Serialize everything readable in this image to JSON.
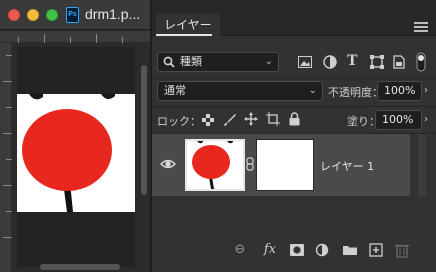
{
  "document": {
    "title": "drm1.p...",
    "app_badge": "Ps"
  },
  "panel": {
    "tab_label": "レイヤー",
    "filter": {
      "kind_label": "種類"
    },
    "blend_mode": "通常",
    "opacity_label": "不透明度：",
    "opacity_value": "100%",
    "lock_label": "ロック：",
    "fill_label": "塗り：",
    "fill_value": "100%",
    "layers": [
      {
        "name": "レイヤー 1",
        "visible": true,
        "selected": true
      }
    ]
  },
  "colors": {
    "panel_bg": "#323232",
    "selected_row": "#4a4a4a",
    "red_circle": "#e8271e",
    "ps_blue": "#31a8ff"
  }
}
